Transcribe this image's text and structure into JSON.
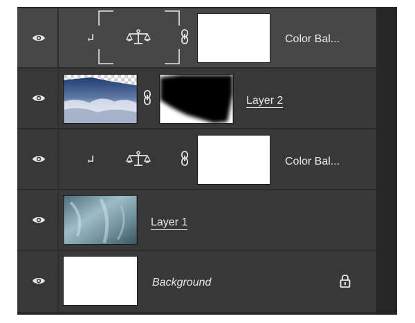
{
  "layers_panel": {
    "layers": [
      {
        "name": "Color Bal...",
        "type": "adjustment",
        "adjustment": "color-balance",
        "clipped": true,
        "selected": true
      },
      {
        "name": "Layer 2",
        "type": "pixel",
        "has_mask": true,
        "selected": false
      },
      {
        "name": "Color Bal...",
        "type": "adjustment",
        "adjustment": "color-balance",
        "clipped": true,
        "selected": false
      },
      {
        "name": "Layer 1",
        "type": "pixel",
        "selected": false
      },
      {
        "name": "Background",
        "type": "background",
        "locked": true,
        "selected": false
      }
    ],
    "icons": {
      "visibility": "eye-icon",
      "link": "chain-link-icon",
      "adjustment": "balance-scale-icon",
      "clip": "clipping-arrow-icon",
      "lock": "lock-icon"
    },
    "colors": {
      "panel_bg": "#282828",
      "row_bg": "#383838",
      "selected_row_bg": "#474747",
      "text": "#e8e8e8"
    }
  }
}
